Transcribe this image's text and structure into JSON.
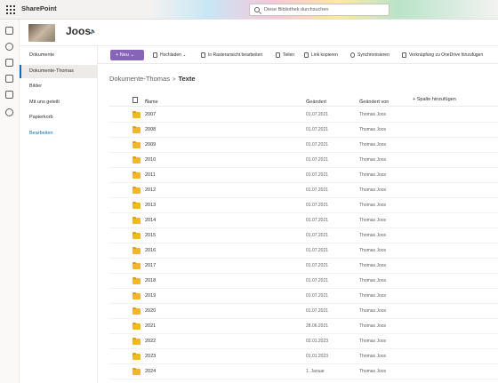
{
  "suite": {
    "brand": "SharePoint",
    "search_placeholder": "Diese Bibliothek durchsuchen"
  },
  "site": {
    "title": "Joos"
  },
  "nav": {
    "items": [
      {
        "label": "Dokumente",
        "selected": false
      },
      {
        "label": "Dokumente-Thomas",
        "selected": true
      },
      {
        "label": "Bilder",
        "selected": false
      },
      {
        "label": "Mit uns geteilt",
        "selected": false
      },
      {
        "label": "Papierkorb",
        "selected": false
      }
    ],
    "edit_label": "Bearbeiten"
  },
  "commandbar": {
    "new_label": "Neu",
    "upload_label": "Hochladen",
    "grid_label": "In Rasteransicht bearbeiten",
    "share_label": "Teilen",
    "copylink_label": "Link kopieren",
    "sync_label": "Synchronisieren",
    "onedrive_label": "Verknüpfung zu OneDrive hinzufügen"
  },
  "breadcrumb": {
    "parent": "Dokumente-Thomas",
    "separator": ">",
    "current": "Texte"
  },
  "columns": {
    "name": "Name",
    "modified": "Geändert",
    "modified_by": "Geändert von",
    "add_column": "+ Spalte hinzufügen"
  },
  "rows": [
    {
      "name": "2007",
      "modified": "01.07.2021",
      "modified_by": "Thomas Joos"
    },
    {
      "name": "2008",
      "modified": "01.07.2021",
      "modified_by": "Thomas Joos"
    },
    {
      "name": "2009",
      "modified": "01.07.2021",
      "modified_by": "Thomas Joos"
    },
    {
      "name": "2010",
      "modified": "01.07.2021",
      "modified_by": "Thomas Joos"
    },
    {
      "name": "2011",
      "modified": "01.07.2021",
      "modified_by": "Thomas Joos"
    },
    {
      "name": "2012",
      "modified": "01.07.2021",
      "modified_by": "Thomas Joos"
    },
    {
      "name": "2013",
      "modified": "01.07.2021",
      "modified_by": "Thomas Joos"
    },
    {
      "name": "2014",
      "modified": "01.07.2021",
      "modified_by": "Thomas Joos"
    },
    {
      "name": "2015",
      "modified": "01.07.2021",
      "modified_by": "Thomas Joos"
    },
    {
      "name": "2016",
      "modified": "01.07.2021",
      "modified_by": "Thomas Joos"
    },
    {
      "name": "2017",
      "modified": "01.07.2021",
      "modified_by": "Thomas Joos"
    },
    {
      "name": "2018",
      "modified": "01.07.2021",
      "modified_by": "Thomas Joos"
    },
    {
      "name": "2019",
      "modified": "01.07.2021",
      "modified_by": "Thomas Joos"
    },
    {
      "name": "2020",
      "modified": "01.07.2021",
      "modified_by": "Thomas Joos"
    },
    {
      "name": "2021",
      "modified": "28.06.2021",
      "modified_by": "Thomas Joos"
    },
    {
      "name": "2022",
      "modified": "02.01.2023",
      "modified_by": "Thomas Joos"
    },
    {
      "name": "2023",
      "modified": "01.01.2023",
      "modified_by": "Thomas Joos"
    },
    {
      "name": "2024",
      "modified": "1. Januar",
      "modified_by": "Thomas Joos"
    }
  ]
}
